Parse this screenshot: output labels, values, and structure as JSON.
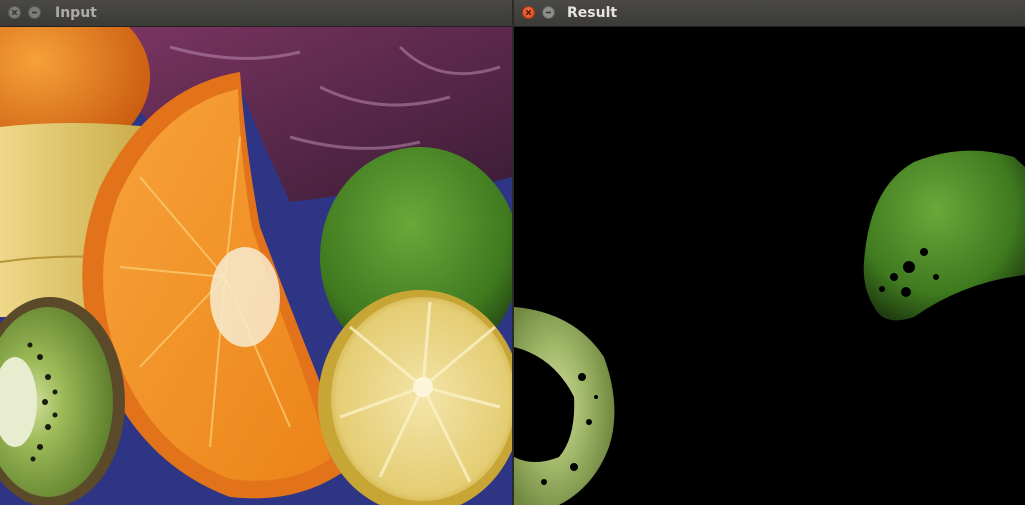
{
  "windows": {
    "input": {
      "title": "Input",
      "state": "inactive",
      "buttons": {
        "close": "close-icon",
        "minimize": "minimize-icon"
      }
    },
    "result": {
      "title": "Result",
      "state": "active",
      "buttons": {
        "close": "close-icon",
        "minimize": "minimize-icon"
      }
    }
  },
  "colors": {
    "orange": "#f0921e",
    "orange_rind": "#e86f10",
    "lime": "#4f8e26",
    "lemon": "#e7d27c",
    "kiwi": "#8fae52",
    "cabbage": "#5a2a4e",
    "banana": "#e2c866",
    "background_blue": "#3b3f9a",
    "titlebar": "#3f3e3a"
  }
}
